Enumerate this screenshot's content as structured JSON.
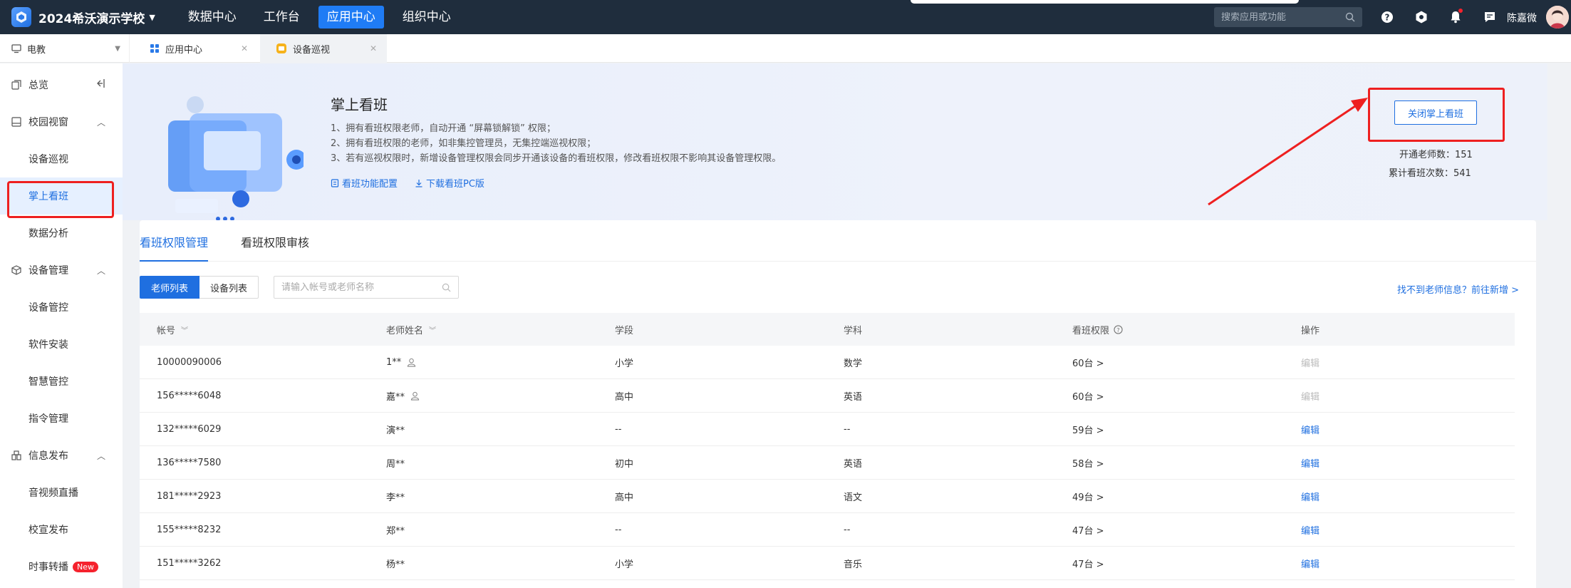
{
  "topbar": {
    "school": "2024希沃演示学校",
    "nav": [
      "数据中心",
      "工作台",
      "应用中心",
      "组织中心"
    ],
    "active_nav": "应用中心",
    "search_placeholder": "搜索应用或功能",
    "username": "陈嘉微"
  },
  "tabs": [
    {
      "label": "电教"
    },
    {
      "label": "应用中心"
    },
    {
      "label": "设备巡视"
    }
  ],
  "sidebar": {
    "items": [
      {
        "label": "总览"
      },
      {
        "label": "校园视窗"
      },
      {
        "label": "设备巡视"
      },
      {
        "label": "掌上看班"
      },
      {
        "label": "数据分析"
      },
      {
        "label": "设备管理"
      },
      {
        "label": "设备管控"
      },
      {
        "label": "软件安装"
      },
      {
        "label": "智慧管控"
      },
      {
        "label": "指令管理"
      },
      {
        "label": "信息发布"
      },
      {
        "label": "音视频直播"
      },
      {
        "label": "校宣发布"
      },
      {
        "label": "时事转播"
      }
    ],
    "new_badge": "New"
  },
  "banner": {
    "title": "掌上看班",
    "lines": [
      "1、拥有看班权限老师，自动开通 “屏幕锁解锁” 权限；",
      "2、拥有看班权限的老师，如非集控管理员，无集控端巡视权限；",
      "3、若有巡视权限时，新增设备管理权限会同步开通该设备的看班权限，修改看班权限不影响其设备管理权限。"
    ],
    "link_config": "看班功能配置",
    "link_download": "下载看班PC版",
    "close_button": "关闭掌上看班",
    "stat_teachers": "开通老师数：151",
    "stat_times": "累计看班次数：541"
  },
  "panel": {
    "tabs": [
      "看班权限管理",
      "看班权限审核"
    ],
    "seg_on": "老师列表",
    "seg_off": "设备列表",
    "search_placeholder": "请输入帐号或老师名称",
    "add_link": "找不到老师信息？前往新增 >",
    "columns": [
      "帐号",
      "老师姓名",
      "学段",
      "学科",
      "看班权限",
      "操作"
    ],
    "rows": [
      {
        "account": "10000090006",
        "name": "1**",
        "stage": "小学",
        "subject": "数学",
        "perm": "60台 >",
        "op": "编辑"
      },
      {
        "account": "156*****6048",
        "name": "嘉**",
        "stage": "高中",
        "subject": "英语",
        "perm": "60台 >",
        "op": "编辑"
      },
      {
        "account": "132*****6029",
        "name": "演**",
        "stage": "--",
        "subject": "--",
        "perm": "59台 >",
        "op": "编辑"
      },
      {
        "account": "136*****7580",
        "name": "周**",
        "stage": "初中",
        "subject": "英语",
        "perm": "58台 >",
        "op": "编辑"
      },
      {
        "account": "181*****2923",
        "name": "李**",
        "stage": "高中",
        "subject": "语文",
        "perm": "49台 >",
        "op": "编辑"
      },
      {
        "account": "155*****8232",
        "name": "郑**",
        "stage": "--",
        "subject": "--",
        "perm": "47台 >",
        "op": "编辑"
      },
      {
        "account": "151*****3262",
        "name": "杨**",
        "stage": "小学",
        "subject": "音乐",
        "perm": "47台 >",
        "op": "编辑"
      }
    ]
  },
  "colors": {
    "accent": "#1f6fe0",
    "topbar": "#1f2d3d",
    "highlight": "#ee2020"
  }
}
